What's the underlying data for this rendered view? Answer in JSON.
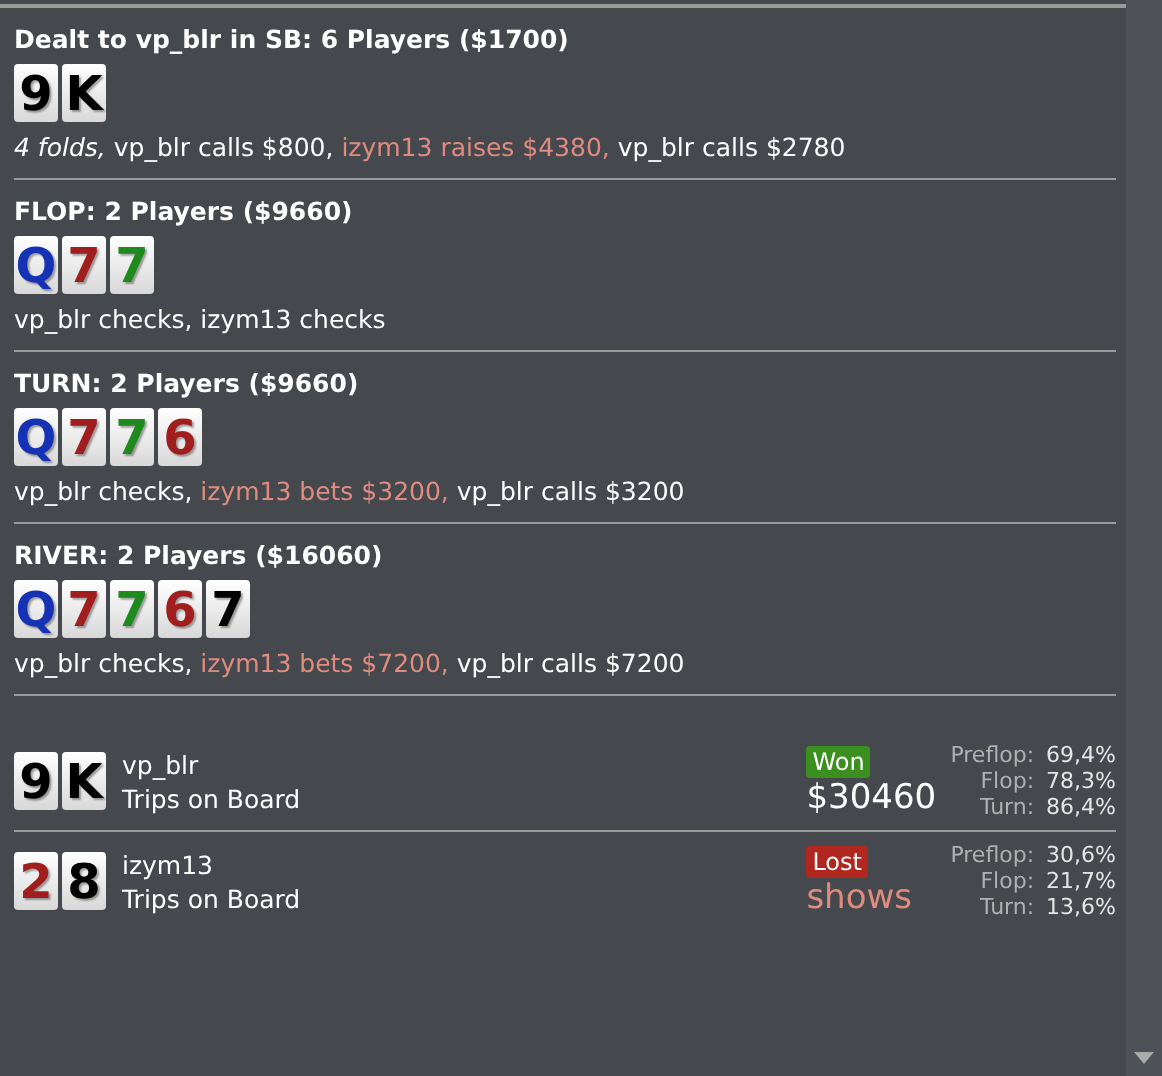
{
  "streets": [
    {
      "title": "Dealt to vp_blr in SB: 6 Players ($1700)",
      "cards": [
        {
          "rank": "9",
          "color": "#000000"
        },
        {
          "rank": "K",
          "color": "#000000"
        }
      ],
      "actions": [
        {
          "text": "4 folds,",
          "kind": "fold"
        },
        {
          "text": "vp_blr calls $800,",
          "kind": "normal"
        },
        {
          "text": "izym13 raises $4380,",
          "kind": "opponent"
        },
        {
          "text": "vp_blr calls $2780",
          "kind": "normal"
        }
      ]
    },
    {
      "title": "FLOP: 2 Players ($9660)",
      "cards": [
        {
          "rank": "Q",
          "color": "#1632b4"
        },
        {
          "rank": "7",
          "color": "#a01e1e"
        },
        {
          "rank": "7",
          "color": "#1e8a1e"
        }
      ],
      "actions": [
        {
          "text": "vp_blr checks, izym13 checks",
          "kind": "normal"
        }
      ]
    },
    {
      "title": "TURN: 2 Players ($9660)",
      "cards": [
        {
          "rank": "Q",
          "color": "#1632b4"
        },
        {
          "rank": "7",
          "color": "#a01e1e"
        },
        {
          "rank": "7",
          "color": "#1e8a1e"
        },
        {
          "rank": "6",
          "color": "#a01e1e"
        }
      ],
      "actions": [
        {
          "text": "vp_blr checks,",
          "kind": "normal"
        },
        {
          "text": "izym13 bets $3200,",
          "kind": "opponent"
        },
        {
          "text": "vp_blr calls $3200",
          "kind": "normal"
        }
      ]
    },
    {
      "title": "RIVER: 2 Players ($16060)",
      "cards": [
        {
          "rank": "Q",
          "color": "#1632b4"
        },
        {
          "rank": "7",
          "color": "#a01e1e"
        },
        {
          "rank": "7",
          "color": "#1e8a1e"
        },
        {
          "rank": "6",
          "color": "#a01e1e"
        },
        {
          "rank": "7",
          "color": "#000000"
        }
      ],
      "actions": [
        {
          "text": "vp_blr checks,",
          "kind": "normal"
        },
        {
          "text": "izym13 bets $7200,",
          "kind": "opponent"
        },
        {
          "text": "vp_blr calls $7200",
          "kind": "normal"
        }
      ]
    }
  ],
  "results": [
    {
      "cards": [
        {
          "rank": "9",
          "color": "#000000"
        },
        {
          "rank": "K",
          "color": "#000000"
        }
      ],
      "name": "vp_blr",
      "hand": "Trips on Board",
      "outcome": {
        "label": "Won",
        "kind": "won"
      },
      "amount": {
        "text": "$30460",
        "kind": "won"
      },
      "stats": [
        {
          "label": "Preflop:",
          "value": "69,4%"
        },
        {
          "label": "Flop:",
          "value": "78,3%"
        },
        {
          "label": "Turn:",
          "value": "86,4%"
        }
      ]
    },
    {
      "cards": [
        {
          "rank": "2",
          "color": "#a01e1e"
        },
        {
          "rank": "8",
          "color": "#000000"
        }
      ],
      "name": "izym13",
      "hand": "Trips on Board",
      "outcome": {
        "label": "Lost",
        "kind": "lost"
      },
      "amount": {
        "text": "shows",
        "kind": "lost"
      },
      "stats": [
        {
          "label": "Preflop:",
          "value": "30,6%"
        },
        {
          "label": "Flop:",
          "value": "21,7%"
        },
        {
          "label": "Turn:",
          "value": "13,6%"
        }
      ]
    }
  ]
}
